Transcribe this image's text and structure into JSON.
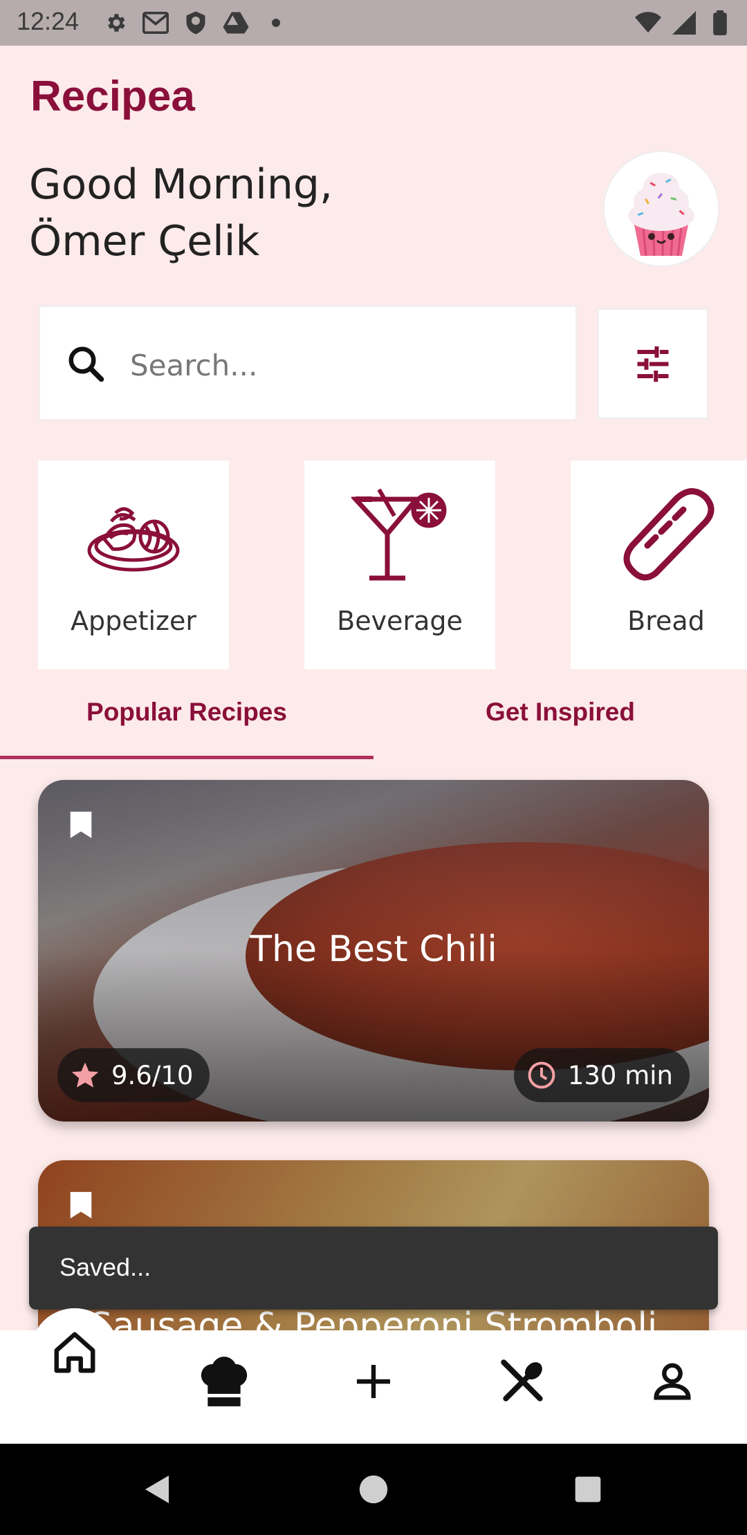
{
  "status_bar": {
    "time": "12:24"
  },
  "app": {
    "title": "Recipea"
  },
  "greeting": {
    "line1": "Good Morning,",
    "line2": "Ömer Çelik"
  },
  "search": {
    "placeholder": "Search..."
  },
  "categories": [
    {
      "label": "Appetizer",
      "icon": "appetizer-plate-icon"
    },
    {
      "label": "Beverage",
      "icon": "cocktail-icon"
    },
    {
      "label": "Bread",
      "icon": "bread-icon"
    }
  ],
  "tabs": [
    {
      "label": "Popular Recipes",
      "selected": true
    },
    {
      "label": "Get Inspired",
      "selected": false
    }
  ],
  "recipes": [
    {
      "title": "The Best Chili",
      "rating": "9.6/10",
      "time": "130 min"
    },
    {
      "title": "Sausage & Pepperoni Stromboli"
    }
  ],
  "snackbar": {
    "message": "Saved..."
  },
  "colors": {
    "brand": "#8a0f3a",
    "background": "#fdeaea",
    "indicator": "#b0315e"
  }
}
